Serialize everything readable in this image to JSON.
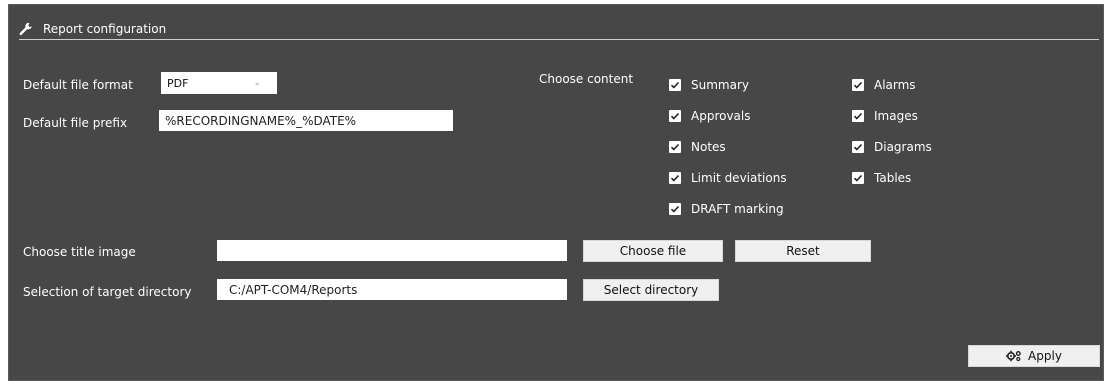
{
  "header": {
    "title": "Report configuration",
    "icon": "wrench-icon"
  },
  "format": {
    "label": "Default file format",
    "value": "PDF"
  },
  "prefix": {
    "label": "Default file prefix",
    "value": "%RECORDINGNAME%_%DATE%"
  },
  "content": {
    "label": "Choose content",
    "left": [
      {
        "label": "Summary",
        "checked": true
      },
      {
        "label": "Approvals",
        "checked": true
      },
      {
        "label": "Notes",
        "checked": true
      },
      {
        "label": "Limit deviations",
        "checked": true
      },
      {
        "label": "DRAFT marking",
        "checked": true
      }
    ],
    "right": [
      {
        "label": "Alarms",
        "checked": true
      },
      {
        "label": "Images",
        "checked": true
      },
      {
        "label": "Diagrams",
        "checked": true
      },
      {
        "label": "Tables",
        "checked": true
      }
    ]
  },
  "title_image": {
    "label": "Choose title image",
    "value": "",
    "choose_label": "Choose file",
    "reset_label": "Reset"
  },
  "target_dir": {
    "label": "Selection of target directory",
    "value": "C:/APT-COM4/Reports",
    "select_label": "Select directory"
  },
  "apply": {
    "label": "Apply",
    "icon": "gears-icon"
  }
}
